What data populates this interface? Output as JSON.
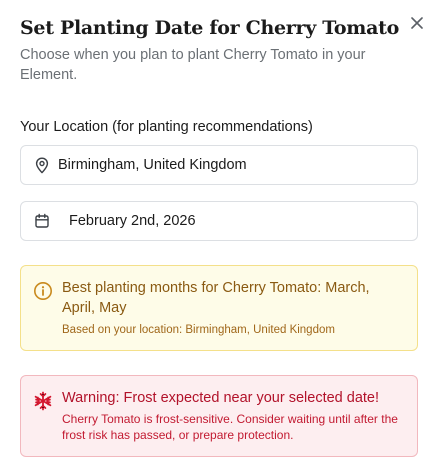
{
  "dialog": {
    "title": "Set Planting Date for Cherry Tomato",
    "subtitle": "Choose when you plan to plant Cherry Tomato in your Element.",
    "close_icon": "close-icon"
  },
  "location": {
    "label": "Your Location (for planting recommendations)",
    "value": "Birmingham, United Kingdom",
    "icon": "map-pin-icon"
  },
  "date": {
    "value": "February 2nd, 2026",
    "icon": "calendar-icon"
  },
  "info_alert": {
    "heading": "Best planting months for Cherry Tomato: March, April, May",
    "detail": "Based on your location: Birmingham, United Kingdom",
    "icon": "info-icon",
    "color": "#8a5a12"
  },
  "warning_alert": {
    "heading": "Warning: Frost expected near your selected date!",
    "detail": "Cherry Tomato is frost-sensitive. Consider waiting until after the frost risk has passed, or prepare protection.",
    "icon": "snowflake-icon",
    "color": "#b2122a"
  }
}
